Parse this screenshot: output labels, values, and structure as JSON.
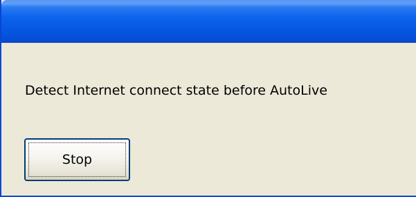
{
  "window": {
    "title": ""
  },
  "dialog": {
    "message": "Detect Internet connect state before AutoLive",
    "stop_label": "Stop"
  },
  "colors": {
    "titlebar": "#0558e3",
    "dialog_bg": "#ece9d8",
    "button_border": "#003c74"
  }
}
